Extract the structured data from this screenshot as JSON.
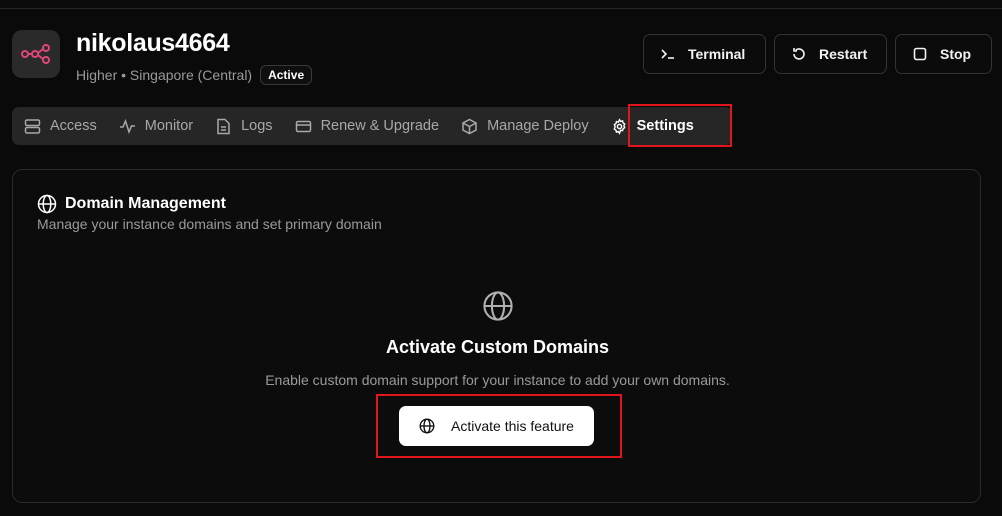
{
  "instance": {
    "name": "nikolaus4664",
    "plan_region": "Higher • Singapore (Central)",
    "status": "Active",
    "brand_color": "#e0457b"
  },
  "actions": {
    "terminal": "Terminal",
    "restart": "Restart",
    "stop": "Stop"
  },
  "tabs": [
    {
      "label": "Access",
      "icon": "server-icon"
    },
    {
      "label": "Monitor",
      "icon": "activity-icon"
    },
    {
      "label": "Logs",
      "icon": "file-text-icon"
    },
    {
      "label": "Renew & Upgrade",
      "icon": "credit-card-icon"
    },
    {
      "label": "Manage Deploy",
      "icon": "package-icon"
    },
    {
      "label": "Settings",
      "icon": "gear-icon",
      "active": true
    }
  ],
  "domain": {
    "title": "Domain Management",
    "description": "Manage your instance domains and set primary domain",
    "cta_title": "Activate Custom Domains",
    "cta_description": "Enable custom domain support for your instance to add your own domains.",
    "cta_button": "Activate this feature"
  },
  "colors": {
    "highlight": "#e0161b",
    "background": "#0a0a0a",
    "tab_bar": "#262626"
  }
}
